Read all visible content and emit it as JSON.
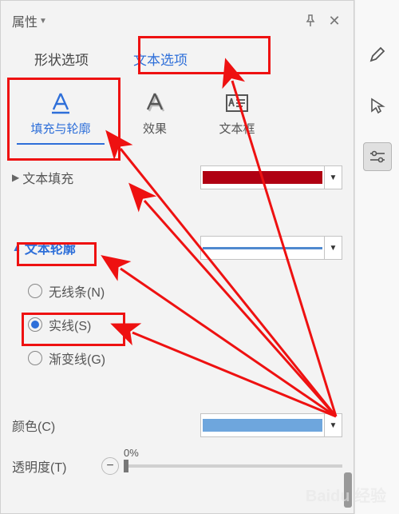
{
  "header": {
    "title": "属性"
  },
  "tabs1": {
    "shape": "形状选项",
    "text": "文本选项"
  },
  "tabs2": {
    "fill": "填充与轮廓",
    "effect": "效果",
    "textbox": "文本框"
  },
  "fill_section": {
    "title": "文本填充"
  },
  "outline_section": {
    "title": "文本轮廓"
  },
  "radios": {
    "none": "无线条(N)",
    "solid": "实线(S)",
    "gradient": "渐变线(G)"
  },
  "color_row": {
    "label": "颜色(C)"
  },
  "opacity": {
    "label": "透明度(T)",
    "value": "0%"
  },
  "watermark": "Baidu 经验"
}
